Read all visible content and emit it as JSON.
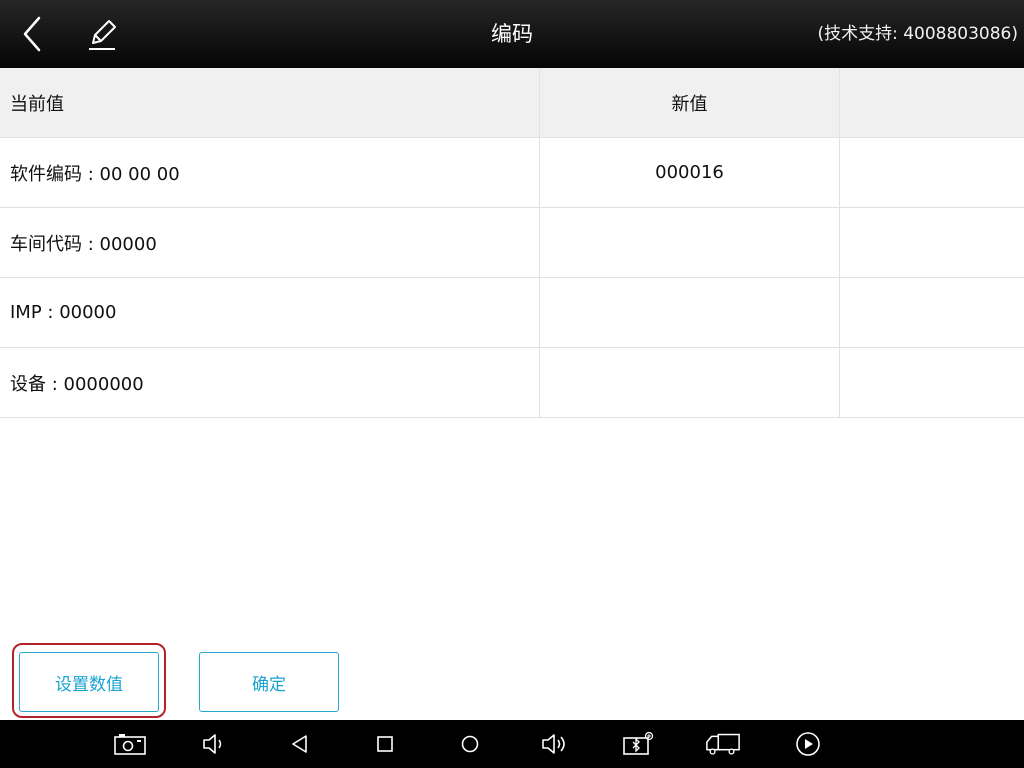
{
  "header": {
    "title": "编码",
    "support": "(技术支持: 4008803086)",
    "back_icon": "back-arrow-icon",
    "edit_icon": "pencil-icon"
  },
  "table": {
    "columns": [
      "当前值",
      "新值",
      ""
    ],
    "rows": [
      {
        "current": "软件编码 : 00 00 00",
        "new": "000016",
        "extra": ""
      },
      {
        "current": "车间代码 : 00000",
        "new": "",
        "extra": ""
      },
      {
        "current": "IMP : 00000",
        "new": "",
        "extra": ""
      },
      {
        "current": "设备 : 0000000",
        "new": "",
        "extra": ""
      }
    ]
  },
  "buttons": {
    "set_value": "设置数值",
    "confirm": "确定"
  },
  "colors": {
    "accent": "#1aa3d0",
    "highlight": "#b3232a"
  },
  "navbar": {
    "icons": [
      "screenshot-icon",
      "volume-down-icon",
      "back-icon",
      "recents-icon",
      "home-icon",
      "volume-up-icon",
      "vci-bluetooth-icon",
      "truck-icon",
      "play-icon"
    ]
  }
}
